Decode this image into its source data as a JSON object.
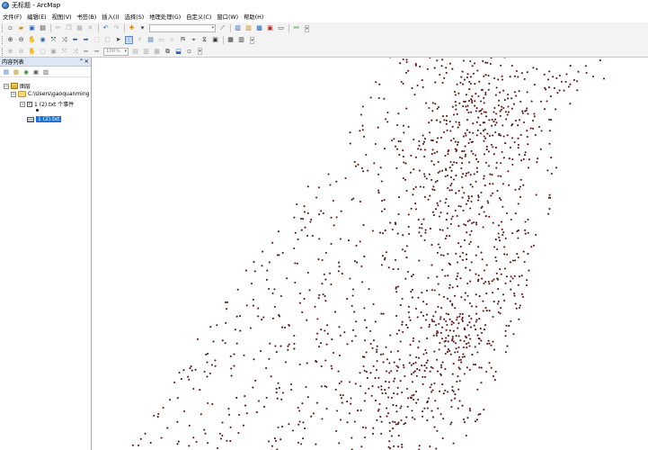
{
  "window": {
    "title": "无标题 - ArcMap"
  },
  "menu": [
    "文件(F)",
    "编辑(E)",
    "视图(V)",
    "书签(B)",
    "插入(I)",
    "选择(S)",
    "地理处理(G)",
    "自定义(C)",
    "窗口(W)",
    "帮助(H)"
  ],
  "toolbar": {
    "scale_value": "",
    "zoom_value": "100%"
  },
  "toc": {
    "title": "内容列表",
    "pin_glyph": "ᵖ",
    "close_glyph": "×",
    "layers_label": "图层",
    "folder_label": "C:\\Users\\gaoquanming",
    "event_layer_label": "1 (2).txt 个事件",
    "table_label": "1 (2).txt",
    "expanded_glyph": "−",
    "checked_glyph": "✓"
  },
  "icons": {
    "new": "new-document-icon",
    "open": "open-folder-icon",
    "save": "save-icon",
    "print": "print-icon",
    "cut": "cut-icon",
    "copy": "copy-icon",
    "paste": "paste-icon",
    "delete": "delete-icon",
    "undo": "undo-icon",
    "redo": "redo-icon",
    "add_data": "add-data-icon",
    "zoom_in": "zoom-in-icon",
    "zoom_out": "zoom-out-icon",
    "pan": "pan-icon",
    "full_extent": "full-extent-icon",
    "identify": "identify-icon",
    "select": "select-arrow-icon"
  },
  "map": {
    "point_color": "#5c1414",
    "background_color": "#ffffff"
  }
}
